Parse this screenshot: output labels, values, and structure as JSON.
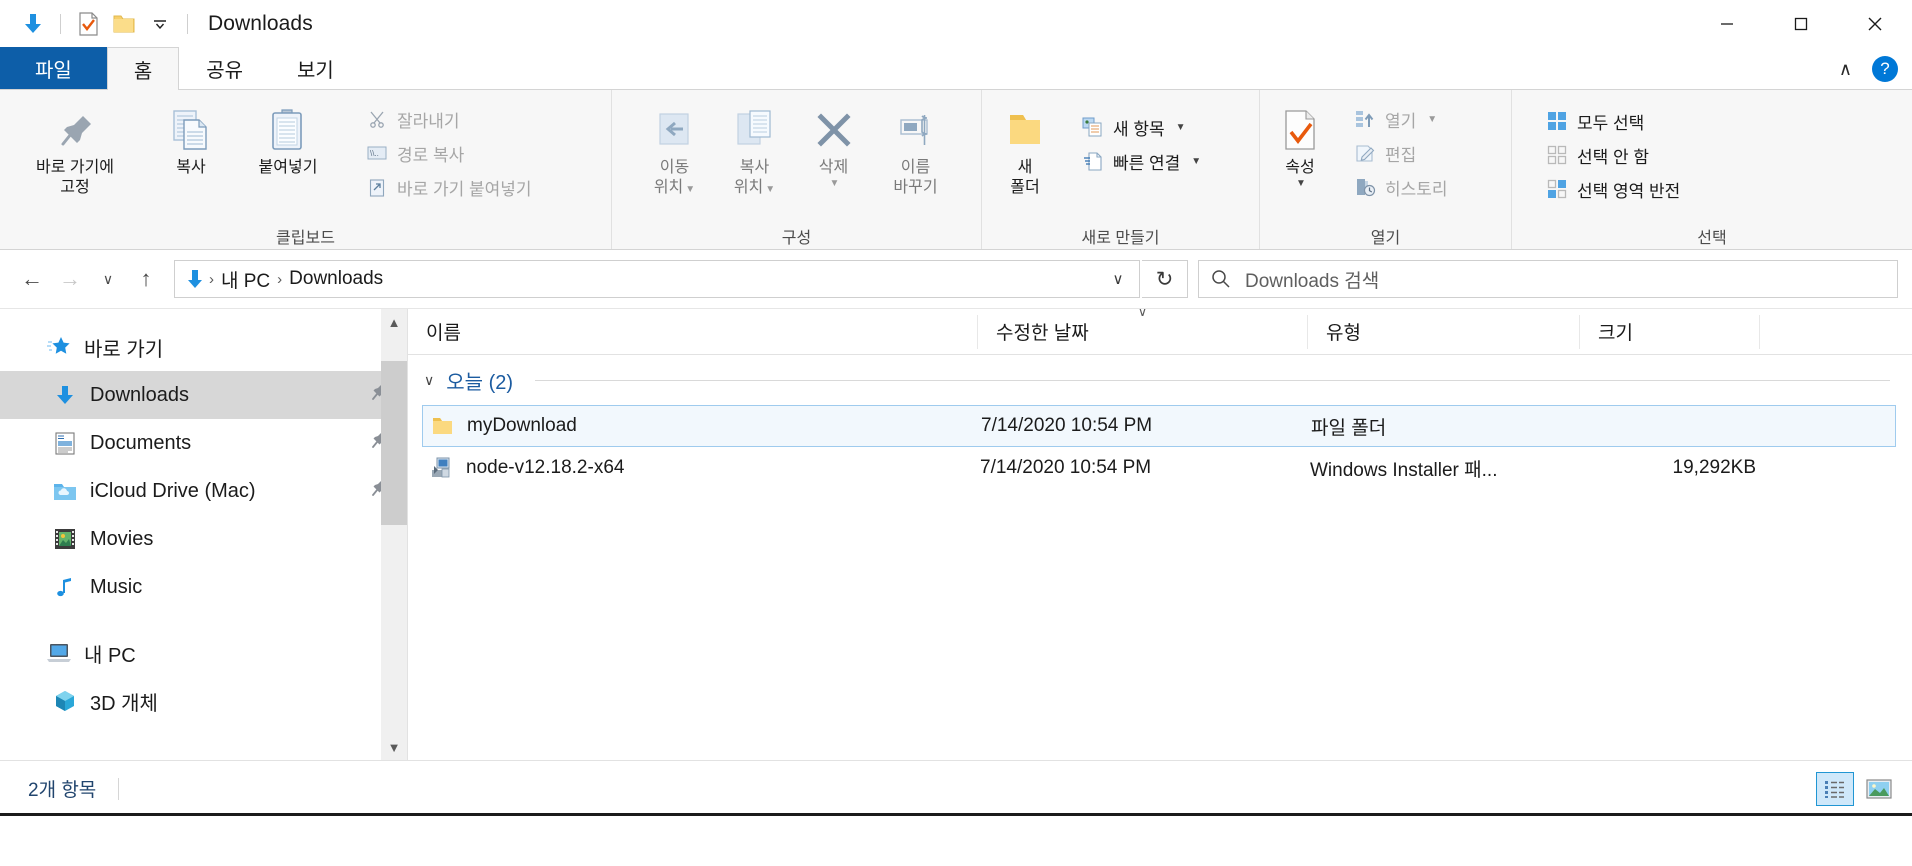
{
  "window": {
    "title": "Downloads",
    "quick_access_icons": [
      "download-arrow-icon",
      "properties-check-icon",
      "new-folder-icon",
      "customize-chevron-icon"
    ],
    "controls": {
      "minimize": "─",
      "maximize": "☐",
      "close": "✕"
    }
  },
  "tabs": [
    {
      "label": "파일",
      "name": "tab-file"
    },
    {
      "label": "홈",
      "name": "tab-home"
    },
    {
      "label": "공유",
      "name": "tab-share"
    },
    {
      "label": "보기",
      "name": "tab-view"
    }
  ],
  "ribbon": {
    "collapse_label": "∧",
    "help_label": "?",
    "groups": [
      {
        "label": "클립보드",
        "big": [
          {
            "label": "바로 가기에\n고정",
            "icon": "pin-icon",
            "line1": "바로 가기에",
            "line2": "고정"
          },
          {
            "label": "복사",
            "icon": "copy-icon",
            "line1": "복사",
            "line2": ""
          },
          {
            "label": "붙여넣기",
            "icon": "paste-icon",
            "line1": "붙여넣기",
            "line2": ""
          }
        ],
        "small": [
          {
            "label": "잘라내기",
            "icon": "scissors-icon",
            "dim": true
          },
          {
            "label": "경로 복사",
            "icon": "copy-path-icon",
            "dim": true
          },
          {
            "label": "바로 가기 붙여넣기",
            "icon": "paste-shortcut-icon",
            "dim": true
          }
        ]
      },
      {
        "label": "구성",
        "big": [
          {
            "line1": "이동",
            "line2": "위치",
            "icon": "move-to-icon",
            "caret": true,
            "dim": true
          },
          {
            "line1": "복사",
            "line2": "위치",
            "icon": "copy-to-icon",
            "caret": true,
            "dim": true
          },
          {
            "line1": "삭제",
            "line2": "",
            "icon": "delete-x-icon",
            "caret": true,
            "dim": true
          },
          {
            "line1": "이름",
            "line2": "바꾸기",
            "icon": "rename-icon",
            "caret": false,
            "dim": true
          }
        ]
      },
      {
        "label": "새로 만들기",
        "big": [
          {
            "line1": "새",
            "line2": "폴더",
            "icon": "new-folder-icon",
            "caret": false,
            "dim": false
          }
        ],
        "small": [
          {
            "label": "새 항목",
            "icon": "new-item-icon",
            "caret": true,
            "dim": false
          },
          {
            "label": "빠른 연결",
            "icon": "easy-access-icon",
            "caret": true,
            "dim": false
          }
        ]
      },
      {
        "label": "열기",
        "big": [
          {
            "line1": "속성",
            "line2": "",
            "icon": "properties-check-icon",
            "caret": true,
            "dim": false
          }
        ],
        "small": [
          {
            "label": "열기",
            "icon": "open-icon",
            "caret": true,
            "dim": true
          },
          {
            "label": "편집",
            "icon": "edit-pencil-icon",
            "caret": false,
            "dim": true
          },
          {
            "label": "히스토리",
            "icon": "history-icon",
            "caret": false,
            "dim": true
          }
        ]
      },
      {
        "label": "선택",
        "small": [
          {
            "label": "모두 선택",
            "icon": "select-all-icon",
            "dim": false
          },
          {
            "label": "선택 안 함",
            "icon": "select-none-icon",
            "dim": false
          },
          {
            "label": "선택 영역 반전",
            "icon": "invert-selection-icon",
            "dim": false
          }
        ]
      }
    ]
  },
  "addressbar": {
    "back": "←",
    "forward": "→",
    "recent": "∨",
    "up": "↑",
    "crumbs": [
      "내 PC",
      "Downloads"
    ],
    "crumb_separator": "›",
    "dropdown": "∨",
    "refresh": "↻",
    "search_placeholder": "Downloads 검색"
  },
  "navpane": {
    "items": [
      {
        "label": "바로 가기",
        "icon": "quick-access-star-icon",
        "root": true,
        "selected": false,
        "pinned": false
      },
      {
        "label": "Downloads",
        "icon": "download-arrow-icon",
        "root": false,
        "selected": true,
        "pinned": true
      },
      {
        "label": "Documents",
        "icon": "documents-icon",
        "root": false,
        "selected": false,
        "pinned": true
      },
      {
        "label": "iCloud Drive (Mac)",
        "icon": "icloud-folder-icon",
        "root": false,
        "selected": false,
        "pinned": true
      },
      {
        "label": "Movies",
        "icon": "movies-filmstrip-icon",
        "root": false,
        "selected": false,
        "pinned": false
      },
      {
        "label": "Music",
        "icon": "music-note-icon",
        "root": false,
        "selected": false,
        "pinned": false
      },
      {
        "label": "내 PC",
        "icon": "this-pc-icon",
        "root": true,
        "selected": false,
        "pinned": false,
        "gap_before": true
      },
      {
        "label": "3D 개체",
        "icon": "3d-objects-icon",
        "root": false,
        "selected": false,
        "pinned": false
      }
    ],
    "pin_glyph": "📌"
  },
  "filelist": {
    "columns": [
      {
        "label": "이름",
        "name": "column-name",
        "sorted": false
      },
      {
        "label": "수정한 날짜",
        "name": "column-date-modified",
        "sorted": true
      },
      {
        "label": "유형",
        "name": "column-type",
        "sorted": false
      },
      {
        "label": "크기",
        "name": "column-size",
        "sorted": false
      }
    ],
    "sort_indicator": "∨",
    "group": {
      "chevron": "∨",
      "label": "오늘 (2)"
    },
    "rows": [
      {
        "name": "myDownload",
        "date": "7/14/2020 10:54 PM",
        "type": "파일 폴더",
        "size": "",
        "icon": "folder-icon",
        "selected": true
      },
      {
        "name": "node-v12.18.2-x64",
        "date": "7/14/2020 10:54 PM",
        "type": "Windows Installer 패...",
        "size": "19,292KB",
        "icon": "msi-installer-icon",
        "selected": false
      }
    ]
  },
  "statusbar": {
    "item_count": "2개 항목",
    "views": [
      {
        "name": "details-view-button",
        "icon": "details-view-icon",
        "active": true
      },
      {
        "name": "large-icons-view-button",
        "icon": "large-icons-view-icon",
        "active": false
      }
    ]
  },
  "colors": {
    "accent": "#0d5ea8",
    "selection": "#d7d7d7",
    "row_selected_bg": "#f2f8fd",
    "row_selected_border": "#9fcbee",
    "group_link": "#1b5ba0",
    "status_text": "#21456e"
  }
}
